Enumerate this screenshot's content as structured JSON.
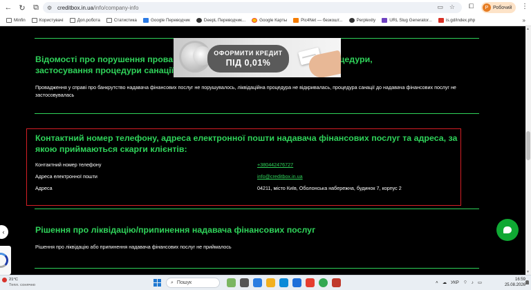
{
  "browser": {
    "url_host": "creditbox.in.ua",
    "url_path": "/info/company-info",
    "profile_name": "Робочий",
    "profile_initial": "P"
  },
  "bookmarks": [
    {
      "label": "Minfin",
      "icon": "folder-icon"
    },
    {
      "label": "Користувачі",
      "icon": "folder-icon"
    },
    {
      "label": "Доп.робота",
      "icon": "folder-icon"
    },
    {
      "label": "Статистика",
      "icon": "folder-icon"
    },
    {
      "label": "Google Переводчик",
      "icon": "translate-icon"
    },
    {
      "label": "DeepL Переводчик...",
      "icon": "deepl-icon"
    },
    {
      "label": "Google Карты",
      "icon": "maps-icon"
    },
    {
      "label": "Pic4Net — безкошт...",
      "icon": "pic4net-icon"
    },
    {
      "label": "Perplexity",
      "icon": "perplexity-icon"
    },
    {
      "label": "URL Slug Generator...",
      "icon": "slug-icon"
    },
    {
      "label": "is.gd/index.php",
      "icon": "isgd-icon"
    }
  ],
  "banner": {
    "line1": "ОФОРМИТИ КРЕДИТ",
    "line2": "ПІД 0,01%"
  },
  "sections": {
    "violations": {
      "title_part1": "Відомості про порушення прова",
      "title_part2": "риття ліквідаційної процедури,",
      "title_line2": "застосування процедури санації",
      "text": "Провадження у справі про банкрутство надавача фінансових послуг не порушувалось, ліквідаційна процедура не відкривалась, процедура санації до надавача фінансових послуг не застосовувалась"
    },
    "contacts": {
      "title": "Контактний номер телефону, адреса електронної пошти надавача фінансових послуг та адреса, за якою приймаються скарги клієнтів:",
      "rows": [
        {
          "label": "Контактний номер телефону",
          "value": "+380442476727",
          "link": true
        },
        {
          "label": "Адреса електронної пошти",
          "value": "info@creditbox.in.ua",
          "link": true
        },
        {
          "label": "Адреса",
          "value": "04211, місто Київ, Оболонська набережна, будинок 7, корпус 2",
          "link": false
        }
      ]
    },
    "liquidation": {
      "title": "Рішення про ліквідацію/припинення надавача фінансових послуг",
      "text": "Рішення про ліквідацію або припинення надавача фінансових послуг не приймалось"
    }
  },
  "taskbar": {
    "weather_temp": "21°C",
    "weather_desc": "Тепл. сонячно",
    "search_placeholder": "Пошук",
    "lang": "УКР",
    "time": "16:59",
    "date": "25.08.2026"
  },
  "colors": {
    "accent_green": "#2fd35a",
    "box_red": "#d71f26",
    "chat_green": "#0fa833"
  }
}
